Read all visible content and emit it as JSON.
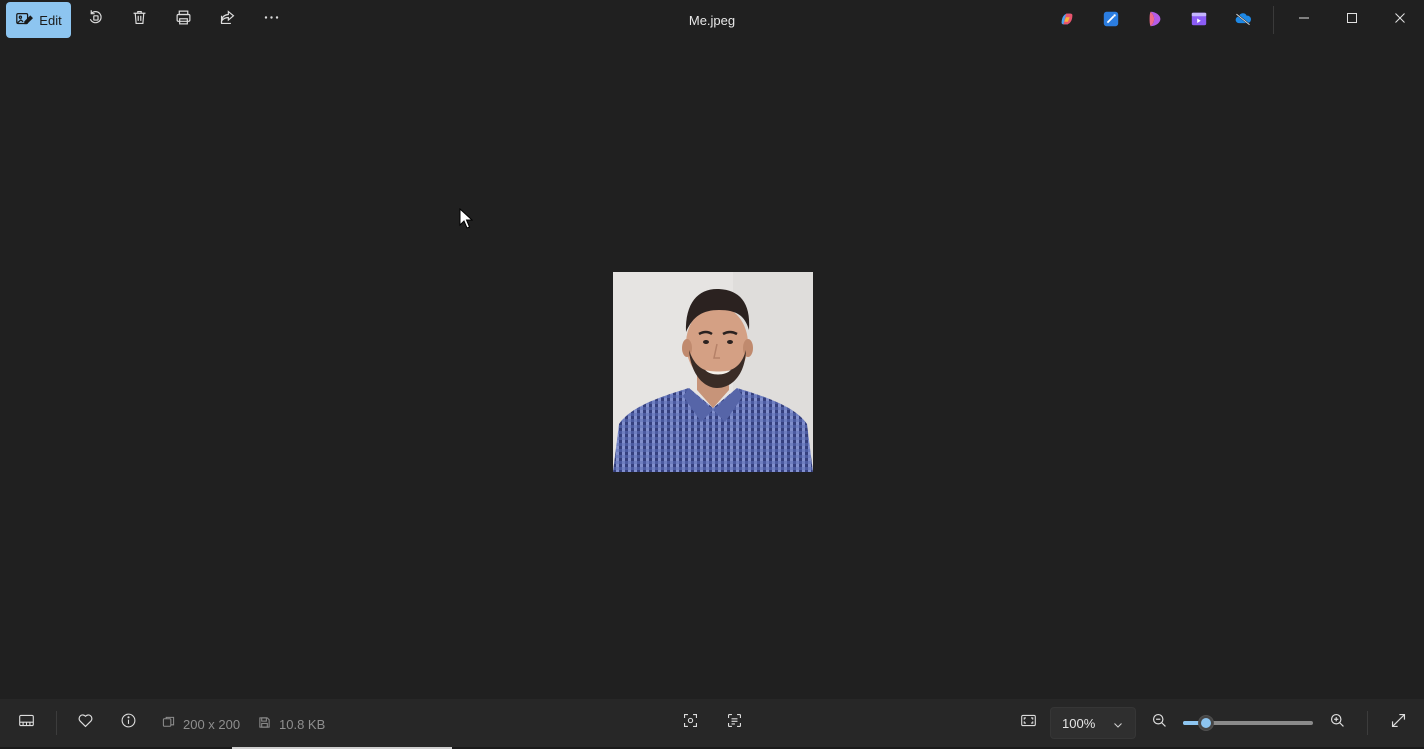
{
  "window": {
    "title": "Me.jpeg"
  },
  "toolbar": {
    "edit_label": "Edit",
    "buttons": [
      "rotate",
      "delete",
      "print",
      "share",
      "more"
    ],
    "app_icons": [
      "copilot-icon",
      "designer-icon",
      "clipchamp-icon",
      "video-editor-icon",
      "onedrive-icon"
    ]
  },
  "image": {
    "alt": "Me.jpeg"
  },
  "status": {
    "dimensions": "200 x 200",
    "file_size": "10.8 KB"
  },
  "zoom": {
    "value": "100%",
    "level_fraction": 0.18
  },
  "colors": {
    "accent": "#8dc5f0",
    "background": "#202020",
    "bottombar": "#272727"
  }
}
